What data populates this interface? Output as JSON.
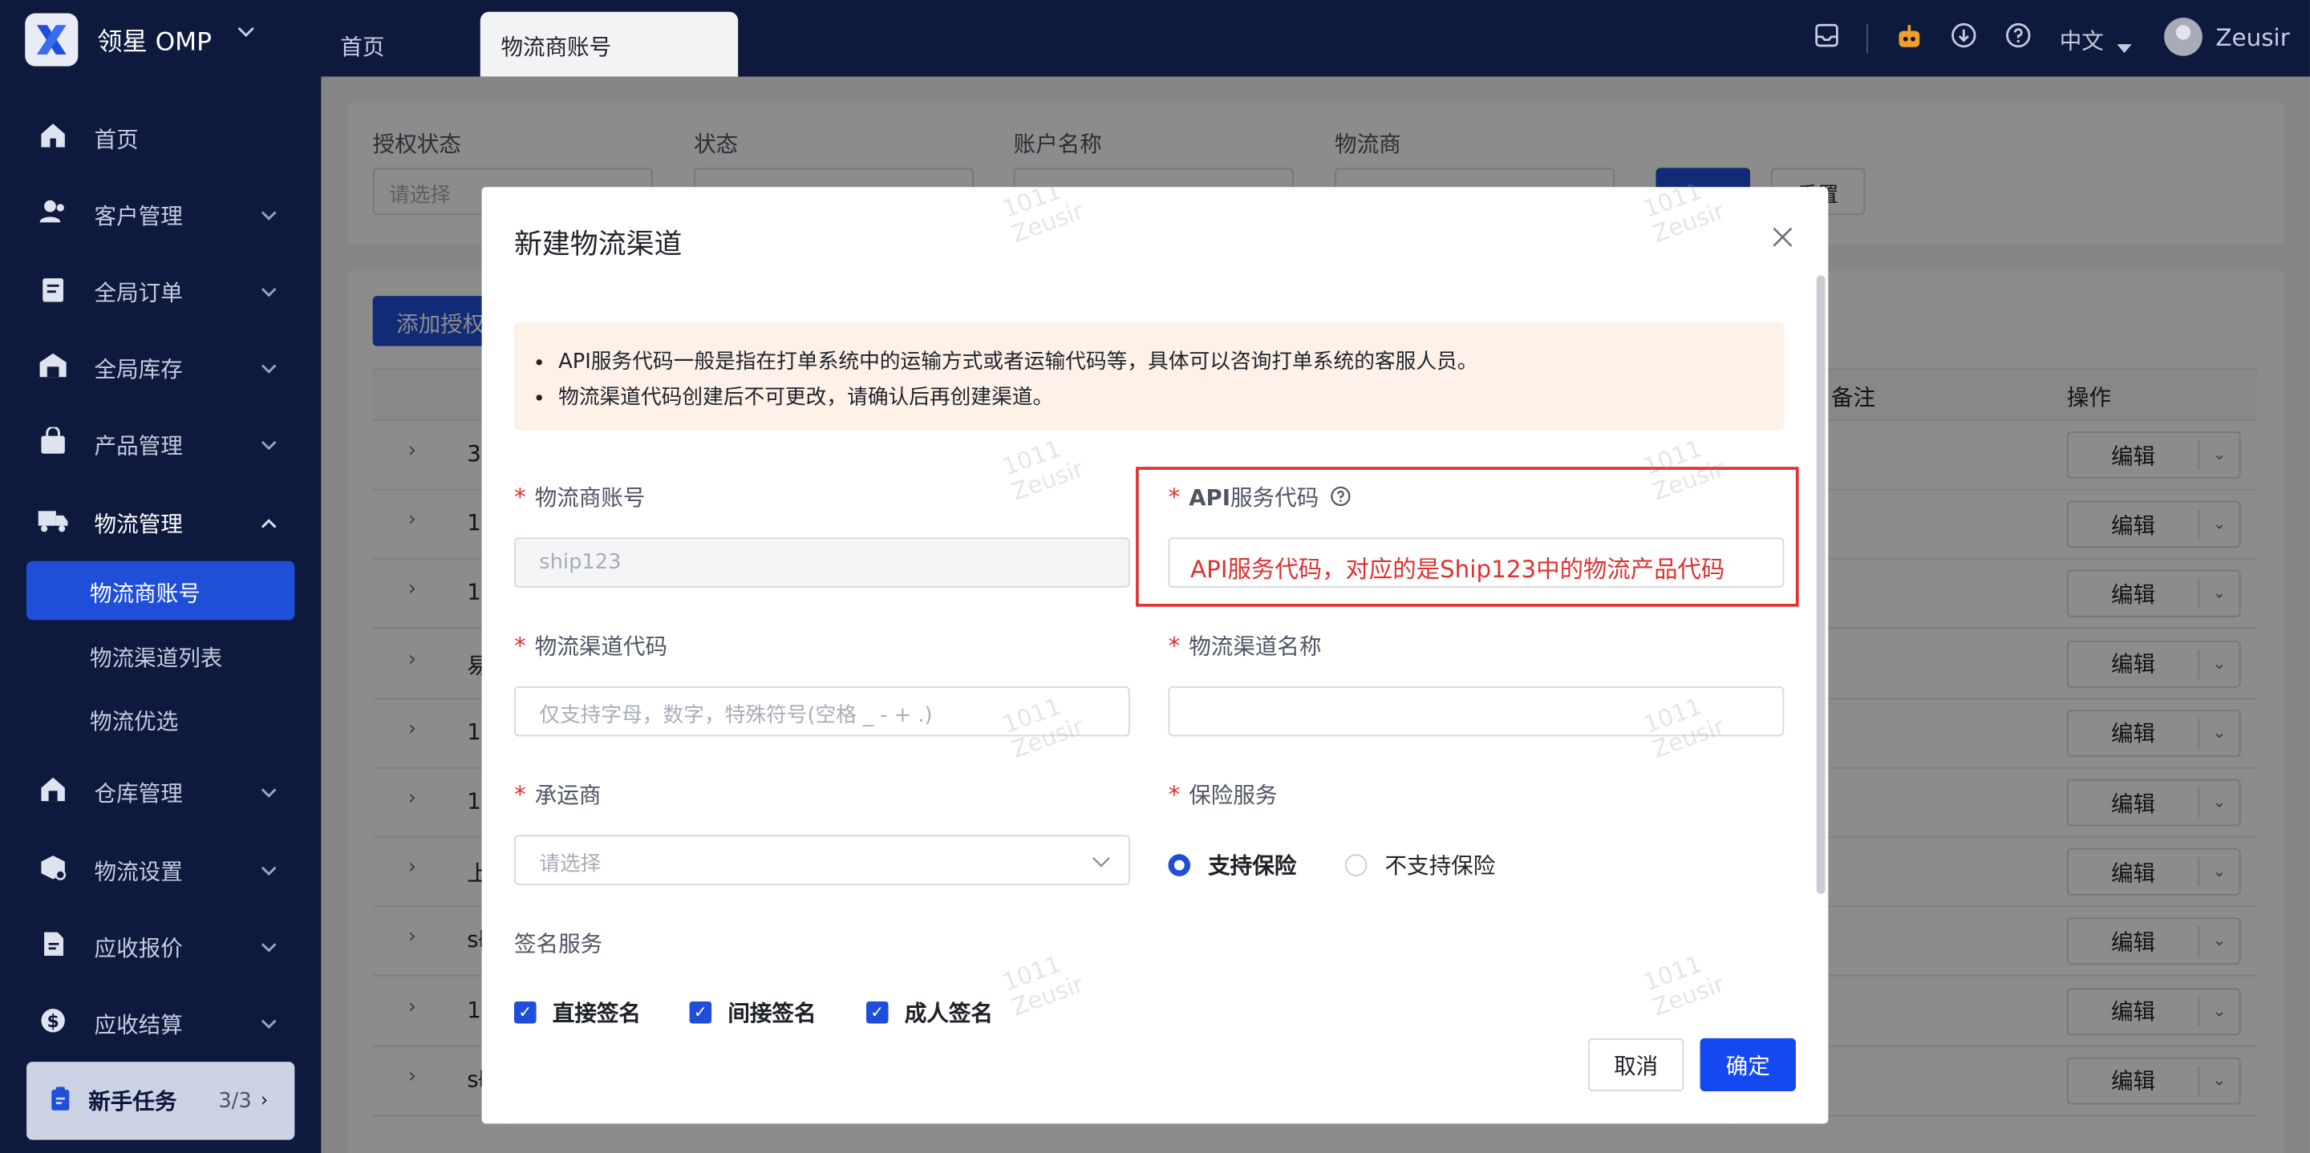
{
  "app": {
    "name": "领星 OMP"
  },
  "tabs": [
    {
      "label": "首页"
    },
    {
      "label": "物流商账号"
    }
  ],
  "header": {
    "language": "中文",
    "username": "Zeusir"
  },
  "sidebar": {
    "items": [
      {
        "label": "首页",
        "icon": "home-icon"
      },
      {
        "label": "客户管理",
        "icon": "users-icon"
      },
      {
        "label": "全局订单",
        "icon": "order-icon"
      },
      {
        "label": "全局库存",
        "icon": "warehouse-icon"
      },
      {
        "label": "产品管理",
        "icon": "bag-icon"
      },
      {
        "label": "物流管理",
        "icon": "truck-icon"
      }
    ],
    "sub_items": [
      {
        "label": "物流商账号"
      },
      {
        "label": "物流渠道列表"
      },
      {
        "label": "物流优选"
      }
    ],
    "items2": [
      {
        "label": "仓库管理",
        "icon": "house-icon"
      },
      {
        "label": "物流设置",
        "icon": "box-settings-icon"
      },
      {
        "label": "应收报价",
        "icon": "doc-icon"
      },
      {
        "label": "应收结算",
        "icon": "dollar-icon"
      }
    ],
    "task": {
      "label": "新手任务",
      "progress": "3/3"
    }
  },
  "filters": {
    "auth_status": {
      "label": "授权状态",
      "placeholder": "请选择"
    },
    "status": {
      "label": "状态"
    },
    "account_name": {
      "label": "账户名称"
    },
    "provider": {
      "label": "物流商"
    },
    "reset": "重置"
  },
  "table": {
    "add_button": "添加授权",
    "col_remark": "备注",
    "col_ops": "操作",
    "row_prefixes": [
      "3",
      "1",
      "1",
      "易",
      "1",
      "1",
      "上",
      "sł",
      "1",
      "sł"
    ],
    "edit_label": "编辑"
  },
  "modal": {
    "title": "新建物流渠道",
    "notices": [
      "API服务代码一般是指在打单系统中的运输方式或者运输代码等，具体可以咨询打单系统的客服人员。",
      "物流渠道代码创建后不可更改，请确认后再创建渠道。"
    ],
    "provider_account": {
      "label": "物流商账号",
      "value": "ship123"
    },
    "api_code": {
      "label_bold": "API",
      "label": "服务代码",
      "value": "API服务代码，对应的是Ship123中的物流产品代码"
    },
    "channel_code": {
      "label": "物流渠道代码",
      "placeholder": "仅支持字母，数字，特殊符号(空格 _ - + .)"
    },
    "channel_name": {
      "label": "物流渠道名称",
      "placeholder": ""
    },
    "carrier": {
      "label": "承运商",
      "placeholder": "请选择"
    },
    "insurance": {
      "label": "保险服务",
      "options": [
        "支持保险",
        "不支持保险"
      ],
      "selected": "支持保险"
    },
    "signature": {
      "label": "签名服务",
      "options": [
        "直接签名",
        "间接签名",
        "成人签名"
      ]
    },
    "cancel": "取消",
    "confirm": "确定"
  },
  "watermark": {
    "id": "1011",
    "name": "Zeusir"
  },
  "colors": {
    "primary": "#1f4fd9",
    "nav_bg": "#0e1a3d",
    "highlight": "#e03131"
  }
}
